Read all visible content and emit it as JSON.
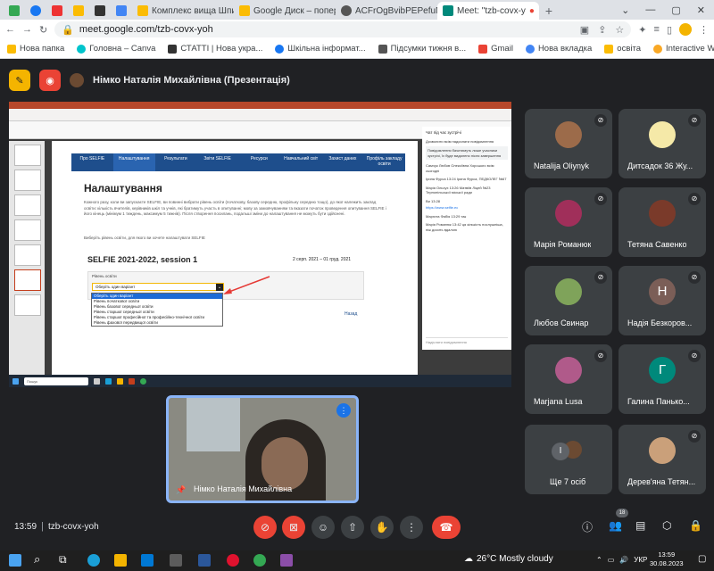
{
  "browser": {
    "tabs": [
      {
        "label": "",
        "color": "#34a853"
      },
      {
        "label": "",
        "color": "#1877f2"
      },
      {
        "label": "",
        "color": "#e33"
      },
      {
        "label": "",
        "color": "#fbbc04"
      },
      {
        "label": "",
        "color": "#333"
      },
      {
        "label": "",
        "color": "#4285f4"
      },
      {
        "label": "Комплекс вища Шпи",
        "color": "#fbbc04"
      },
      {
        "label": "Google Диск – попер",
        "color": "#fbbc04"
      },
      {
        "label": "ACFrOgBvibPEPefuN4",
        "color": "#555"
      },
      {
        "label": "Meet: \"tzb-covx-y",
        "color": "#00897b"
      }
    ],
    "new_tab": "+",
    "url": "meet.google.com/tzb-covx-yoh",
    "bookmarks": [
      {
        "label": "Нова папка",
        "color": "#fbbc04"
      },
      {
        "label": "Головна – Canva",
        "color": "#00c4cc"
      },
      {
        "label": "СТАТТІ | Нова укра...",
        "color": "#333"
      },
      {
        "label": "Шкільна інформат...",
        "color": "#1877f2"
      },
      {
        "label": "Підсумки тижня в...",
        "color": "#555"
      },
      {
        "label": "Gmail",
        "color": "#ea4335"
      },
      {
        "label": "Нова вкладка",
        "color": "#4285f4"
      },
      {
        "label": "освіта",
        "color": "#fbbc04"
      },
      {
        "label": "Interactive Workshe...",
        "color": "#f9a825"
      }
    ]
  },
  "meet": {
    "presenter_title": "Німко Наталія Михайлівна (Презентація)",
    "slide": {
      "nav": [
        "Про SELFIE",
        "Налаштування",
        "Результати",
        "Звіти SELFIE",
        "Ресурси",
        "Навчальний світ",
        "Захист даних",
        "Профіль закладу освіти"
      ],
      "title": "Налаштування",
      "paragraph": "Кожного разу, коли ви запускаєте SELFIE, ви повинні вибрати рівень освіти (початкову, базову середню, профільну середню тощо), до якої належить заклад освіти: кількість вчителів, керівників шкіл та учнів, які братимуть участь в опитуванні; мову за замовчуванням та вказати початок проведення опитування SELFIE і його кінець (мінімум 1 тиждень, максимум 5 тижнів). Після створення посилань, подальші зміни до налаштування не можуть бути здійснені.",
      "note": "Виберіть рівень освіти, для якого ви хочете налаштувати SELFIE",
      "session_title": "SELFIE 2021-2022, session 1",
      "session_dates": "2 серп. 2021 – 01 груд. 2021",
      "level_label": "Рівень освіти",
      "select_value": "Оберіть один варіант",
      "options": [
        "Оберіть один варіант",
        "Рівень початкової освіти",
        "Рівень базової середньої освіти",
        "Рівень старшої середньої освіти",
        "Рівень старшої професійної та професійно-технічної освіти",
        "Рівень фахової передвищої освіти"
      ],
      "next": "Назад"
    },
    "chat": {
      "title": "Чат під час зустрічі",
      "toggle": "Дозволити всім надсилати повідомлення",
      "notice": "Повідомлення бачитимуть лише учасники зустрічі, їх буде видалено після завершення",
      "messages": [
        "Самчук Любов Олексіївна   Хорошого всім сьогодні",
        "Ірина Фурса   13:24   Ірина Фурса, ПЕДКОЛЕГ №67",
        "Марія Ольхух   13:26   Матвіїв Ліцей №23 Тернопільської міської ради",
        "Ви   13:28",
        "https://www.selfie.ec",
        "Маргита Фабія   13:29   так",
        "Марія Романюк   13:42   ця кількість послушніша, ніж досить вдалою"
      ],
      "input_placeholder": "Надіслати повідомлення"
    },
    "inner_taskbar_search": "Пошук",
    "participants": [
      {
        "name": "Natalija Oliynyk",
        "initial": "",
        "color": "#9c6b4a"
      },
      {
        "name": "Дитсадок 36 Жу...",
        "initial": "",
        "color": "#f5e9a8"
      },
      {
        "name": "Марія Романюк",
        "initial": "",
        "color": "#a02f5a"
      },
      {
        "name": "Тетяна Савенко",
        "initial": "",
        "color": "#7a3a2a"
      },
      {
        "name": "Любов Свинар",
        "initial": "",
        "color": "#7fa35a"
      },
      {
        "name": "Надія Безкоров...",
        "initial": "Н",
        "color": "#7b5e57"
      },
      {
        "name": "Marjana Lusa",
        "initial": "",
        "color": "#b05a8a"
      },
      {
        "name": "Галина Панько...",
        "initial": "Г",
        "color": "#00897b"
      },
      {
        "name": "Ще 7 осіб",
        "initial": "І",
        "color": "#5f6368"
      },
      {
        "name": "Дерев'яна Тетян...",
        "initial": "",
        "color": "#caa07a"
      }
    ],
    "self_name": "Німко Наталія Михайлівна",
    "time": "13:59",
    "code": "tzb-covx-yoh",
    "participant_count": "18"
  },
  "taskbar": {
    "weather": "26°C  Mostly cloudy",
    "lang": "УКР",
    "time": "13:59",
    "date": "30.08.2023"
  }
}
